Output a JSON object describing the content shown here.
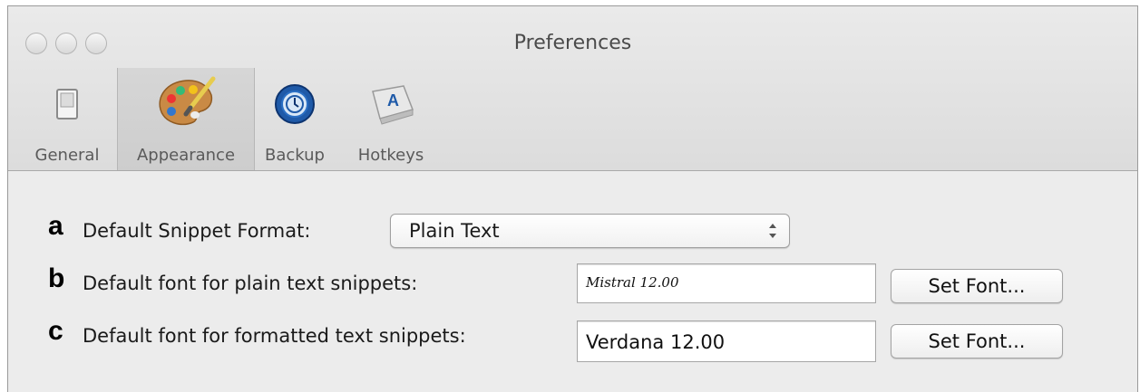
{
  "window": {
    "title": "Preferences"
  },
  "tabs": [
    {
      "label": "General",
      "icon": "toggle-switch-icon"
    },
    {
      "label": "Appearance",
      "icon": "paint-palette-icon",
      "selected": true
    },
    {
      "label": "Backup",
      "icon": "time-machine-icon"
    },
    {
      "label": "Hotkeys",
      "icon": "keyboard-key-icon"
    }
  ],
  "rows": [
    {
      "letter": "a",
      "label": "Default Snippet Format:",
      "value": "Plain Text"
    },
    {
      "letter": "b",
      "label": "Default font for plain text snippets:",
      "value": "Mistral 12.00",
      "button": "Set Font..."
    },
    {
      "letter": "c",
      "label": "Default font for formatted text snippets:",
      "value": "Verdana 12.00",
      "button": "Set Font..."
    }
  ]
}
